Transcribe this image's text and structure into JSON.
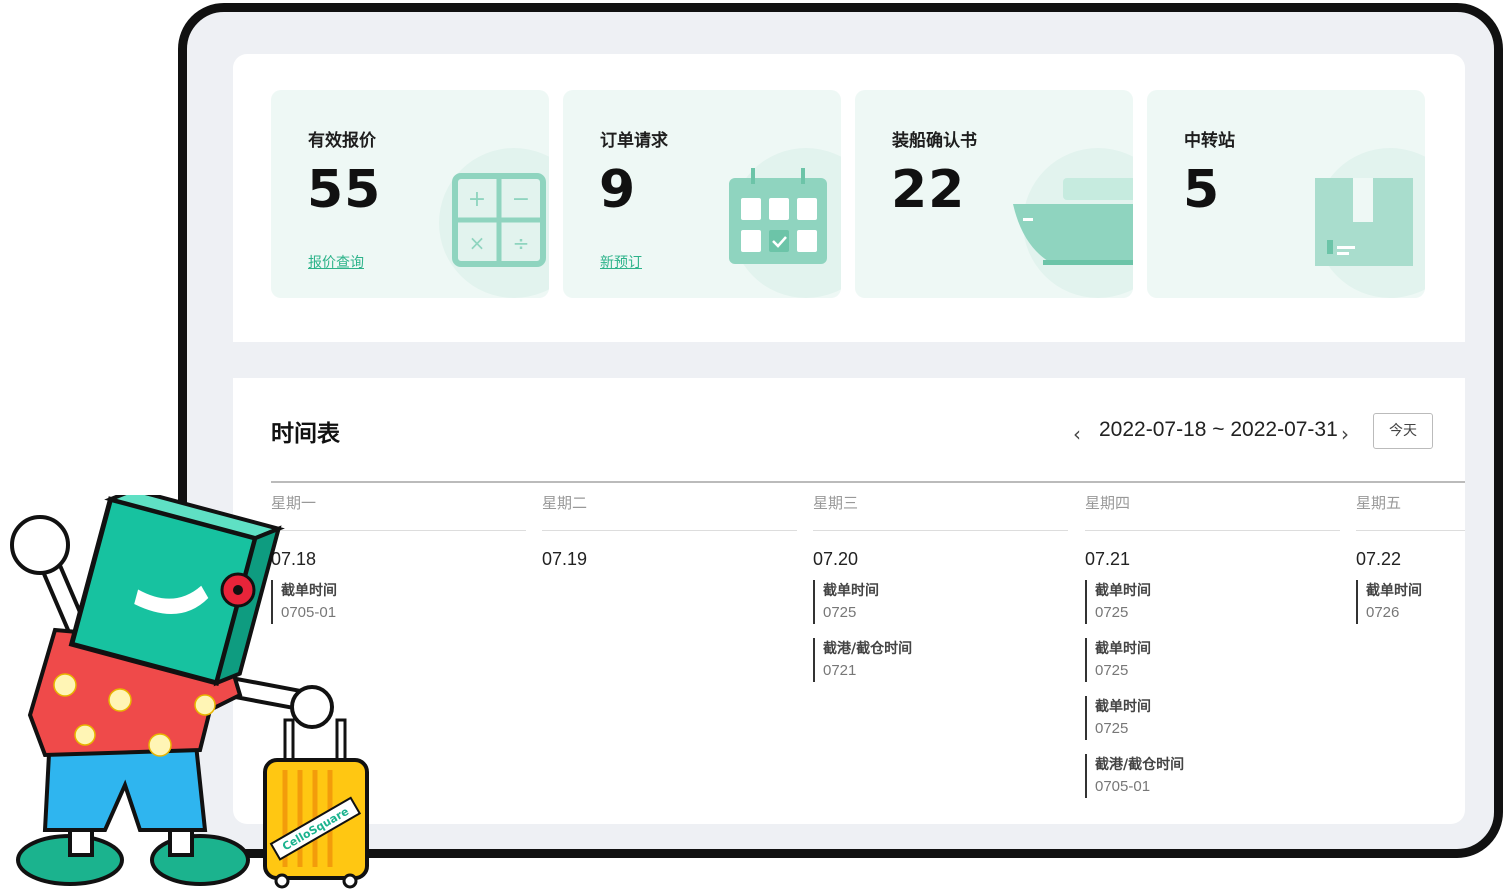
{
  "cards": [
    {
      "title": "有效报价",
      "value": "55",
      "link": "报价查询",
      "icon": "calculator-icon"
    },
    {
      "title": "订单请求",
      "value": "9",
      "link": "新预订",
      "icon": "calendar-icon"
    },
    {
      "title": "装船确认书",
      "value": "22",
      "link": "",
      "icon": "ship-icon"
    },
    {
      "title": "中转站",
      "value": "5",
      "link": "",
      "icon": "box-icon"
    }
  ],
  "schedule": {
    "title": "时间表",
    "date_range": "2022-07-18 ~ 2022-07-31",
    "today_label": "今天",
    "days": [
      {
        "name": "星期一",
        "date": "07.18",
        "events": [
          {
            "label": "截单时间",
            "value": "0705-01"
          }
        ]
      },
      {
        "name": "星期二",
        "date": "07.19",
        "events": []
      },
      {
        "name": "星期三",
        "date": "07.20",
        "events": [
          {
            "label": "截单时间",
            "value": "0725"
          },
          {
            "label": "截港/截仓时间",
            "value": "0721"
          }
        ]
      },
      {
        "name": "星期四",
        "date": "07.21",
        "events": [
          {
            "label": "截单时间",
            "value": "0725"
          },
          {
            "label": "截单时间",
            "value": "0725"
          },
          {
            "label": "截单时间",
            "value": "0725"
          },
          {
            "label": "截港/截仓时间",
            "value": "0705-01"
          }
        ]
      },
      {
        "name": "星期五",
        "date": "07.22",
        "events": [
          {
            "label": "截单时间",
            "value": "0726"
          }
        ]
      }
    ]
  },
  "mascot": {
    "luggage_text": "CelloSquare"
  },
  "colors": {
    "accent": "#2db38a",
    "card_bg": "#eef8f5",
    "icon": "#8fd4bf"
  }
}
